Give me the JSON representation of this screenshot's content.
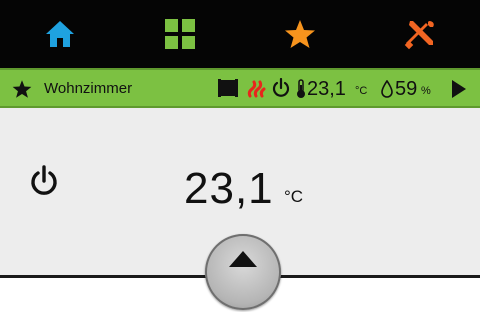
{
  "navbar": {
    "items": [
      {
        "name": "home",
        "icon": "home-icon",
        "color": "#1fa2e0"
      },
      {
        "name": "grid",
        "icon": "grid-icon",
        "color": "#7cc142"
      },
      {
        "name": "favorites",
        "icon": "star-icon",
        "color": "#f7941d"
      },
      {
        "name": "settings",
        "icon": "tools-icon",
        "color": "#f26522"
      }
    ],
    "background": "#050505"
  },
  "statusbar": {
    "room_name": "Wohnzimmer",
    "background": "#7cc142",
    "temperature": "23,1",
    "temperature_unit": "°C",
    "humidity": "59",
    "humidity_unit": "%",
    "icons": [
      "favorite-star-icon",
      "window-blind-icon",
      "heating-icon",
      "power-icon",
      "thermometer-icon",
      "droplet-icon",
      "next-arrow-icon"
    ]
  },
  "main": {
    "temperature": "23,1",
    "temperature_unit": "°C",
    "power_icon": "power-icon",
    "expand_icon": "up-arrow-icon"
  }
}
